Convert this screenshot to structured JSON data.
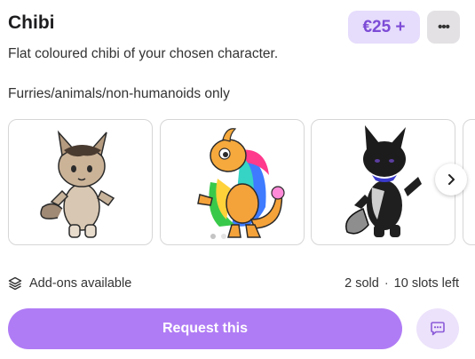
{
  "listing": {
    "title": "Chibi",
    "price": "€25 +",
    "description": "Flat coloured chibi of your chosen character.",
    "note": "Furries/animals/non-humanoids only"
  },
  "gallery": {
    "images": [
      {
        "icon": "tabby-wolf-chibi-image"
      },
      {
        "icon": "rainbow-dragon-chibi-image"
      },
      {
        "icon": "black-wolf-chibi-image"
      }
    ],
    "active_dot": 0,
    "dot_count": 2
  },
  "footer": {
    "addons_label": "Add-ons available",
    "sold": "2 sold",
    "separator": "·",
    "slots": "10 slots left"
  },
  "actions": {
    "request_label": "Request this",
    "chat_icon": "chat-icon",
    "more_icon": "more-options-icon"
  },
  "colors": {
    "accent": "#b07cf5",
    "price_bg": "#e6dcfc",
    "price_text": "#7c4bd6"
  }
}
